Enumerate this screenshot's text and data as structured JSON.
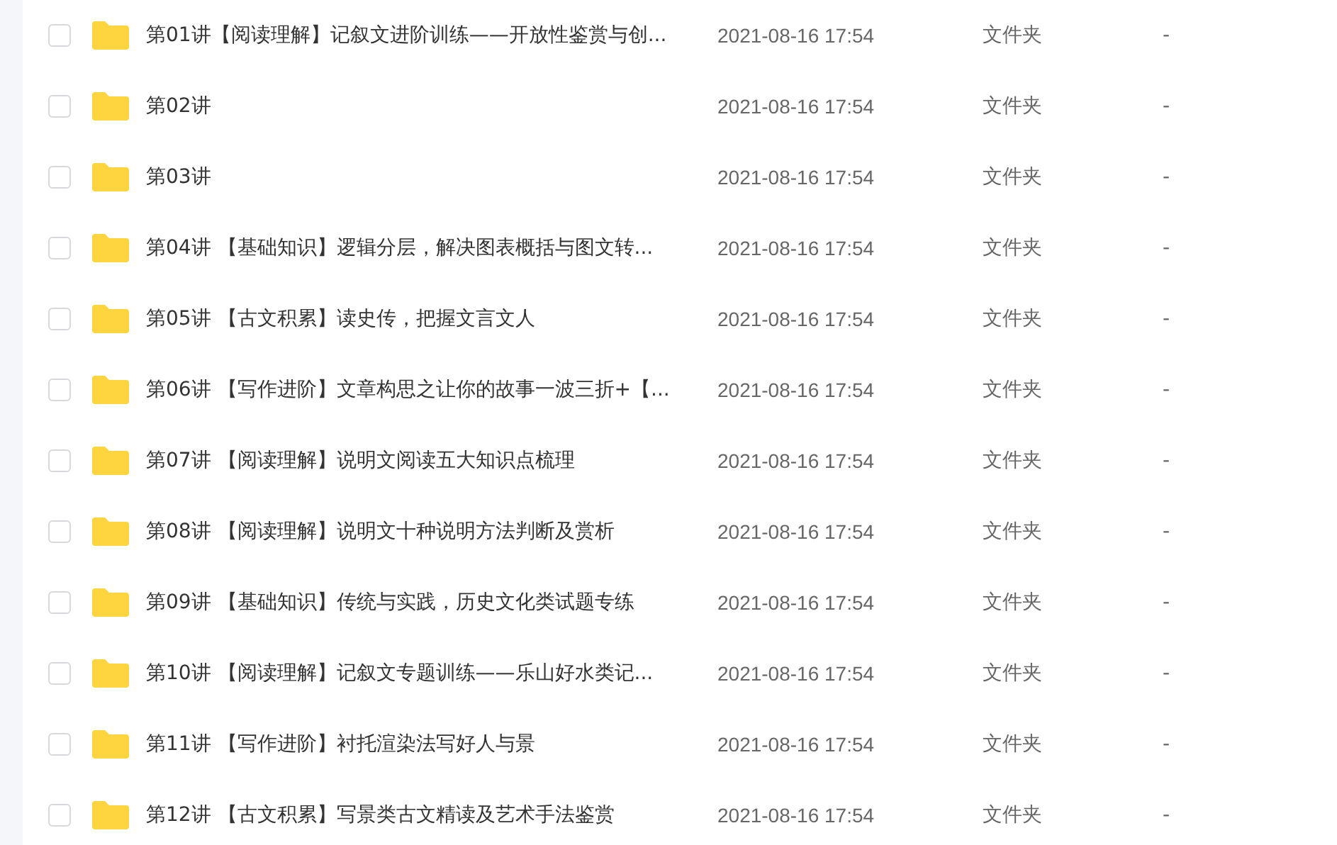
{
  "files": [
    {
      "name": "第01讲【阅读理解】记叙文进阶训练——开放性鉴赏与创...",
      "modified": "2021-08-16 17:54",
      "type": "文件夹",
      "size": "-",
      "checked": false
    },
    {
      "name": "第02讲",
      "modified": "2021-08-16 17:54",
      "type": "文件夹",
      "size": "-",
      "checked": false
    },
    {
      "name": "第03讲",
      "modified": "2021-08-16 17:54",
      "type": "文件夹",
      "size": "-",
      "checked": false
    },
    {
      "name": "第04讲 【基础知识】逻辑分层，解决图表概括与图文转...",
      "modified": "2021-08-16 17:54",
      "type": "文件夹",
      "size": "-",
      "checked": false
    },
    {
      "name": "第05讲 【古文积累】读史传，把握文言文人",
      "modified": "2021-08-16 17:54",
      "type": "文件夹",
      "size": "-",
      "checked": false
    },
    {
      "name": "第06讲 【写作进阶】文章构思之让你的故事一波三折+【...",
      "modified": "2021-08-16 17:54",
      "type": "文件夹",
      "size": "-",
      "checked": false
    },
    {
      "name": "第07讲 【阅读理解】说明文阅读五大知识点梳理",
      "modified": "2021-08-16 17:54",
      "type": "文件夹",
      "size": "-",
      "checked": false
    },
    {
      "name": "第08讲 【阅读理解】说明文十种说明方法判断及赏析",
      "modified": "2021-08-16 17:54",
      "type": "文件夹",
      "size": "-",
      "checked": false
    },
    {
      "name": "第09讲 【基础知识】传统与实践，历史文化类试题专练",
      "modified": "2021-08-16 17:54",
      "type": "文件夹",
      "size": "-",
      "checked": false
    },
    {
      "name": "第10讲 【阅读理解】记叙文专题训练——乐山好水类记...",
      "modified": "2021-08-16 17:54",
      "type": "文件夹",
      "size": "-",
      "checked": false
    },
    {
      "name": "第11讲 【写作进阶】衬托渲染法写好人与景",
      "modified": "2021-08-16 17:54",
      "type": "文件夹",
      "size": "-",
      "checked": false
    },
    {
      "name": "第12讲 【古文积累】写景类古文精读及艺术手法鉴赏",
      "modified": "2021-08-16 17:54",
      "type": "文件夹",
      "size": "-",
      "checked": false
    }
  ]
}
